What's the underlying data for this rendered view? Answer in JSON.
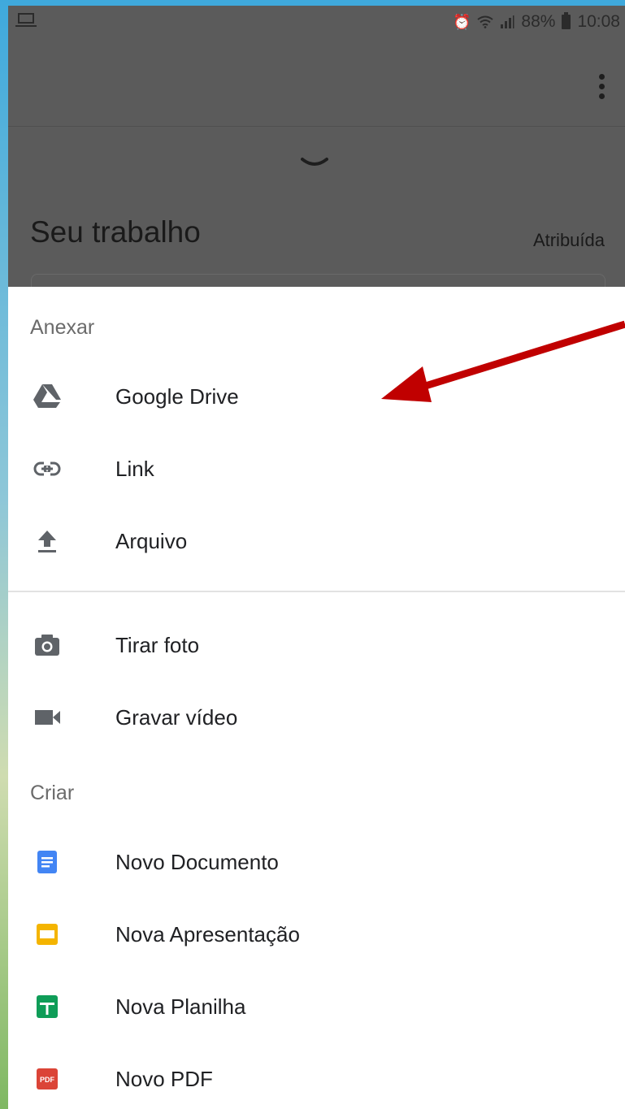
{
  "status_bar": {
    "battery_percent": "88%",
    "time": "10:08"
  },
  "background_screen": {
    "title": "Seu trabalho",
    "status": "Atribuída"
  },
  "sheet": {
    "attach_header": "Anexar",
    "attach_items": [
      {
        "label": "Google Drive",
        "icon": "google-drive-icon"
      },
      {
        "label": "Link",
        "icon": "link-icon"
      },
      {
        "label": "Arquivo",
        "icon": "upload-icon"
      }
    ],
    "capture_items": [
      {
        "label": "Tirar foto",
        "icon": "camera-icon"
      },
      {
        "label": "Gravar vídeo",
        "icon": "video-camera-icon"
      }
    ],
    "create_header": "Criar",
    "create_items": [
      {
        "label": "Novo Documento",
        "icon": "docs-icon",
        "color": "#4285f4"
      },
      {
        "label": "Nova Apresentação",
        "icon": "slides-icon",
        "color": "#f4b400"
      },
      {
        "label": "Nova Planilha",
        "icon": "sheets-icon",
        "color": "#0f9d58"
      },
      {
        "label": "Novo PDF",
        "icon": "pdf-icon",
        "color": "#db4437",
        "badge": "PDF"
      }
    ]
  },
  "annotation": {
    "arrow_color": "#c00000"
  }
}
